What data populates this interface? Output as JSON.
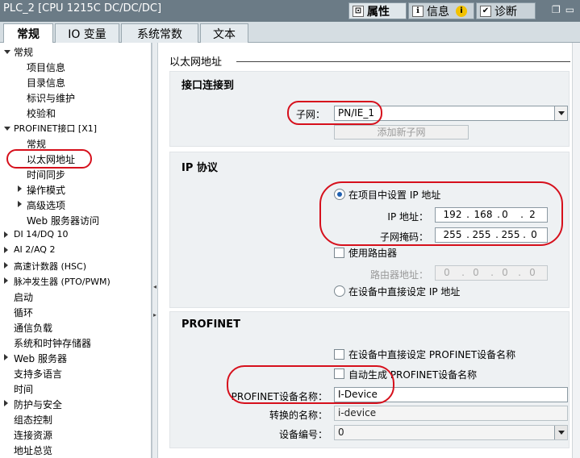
{
  "titlebar": {
    "title": "PLC_2 [CPU 1215C DC/DC/DC]",
    "tabs": [
      {
        "label": "属性",
        "icon": "properties-icon"
      },
      {
        "label": "信息",
        "icon": "info-icon"
      },
      {
        "label": "诊断",
        "icon": "diagnostics-icon"
      }
    ],
    "info_badge": "i"
  },
  "main_tabs": [
    "常规",
    "IO 变量",
    "系统常数",
    "文本"
  ],
  "tree": [
    "常规",
    "项目信息",
    "目录信息",
    "标识与维护",
    "校验和",
    "PROFINET接口 [X1]",
    "常规",
    "以太网地址",
    "时间同步",
    "操作模式",
    "高级选项",
    "Web 服务器访问",
    "DI 14/DQ 10",
    "AI 2/AQ 2",
    "高速计数器 (HSC)",
    "脉冲发生器 (PTO/PWM)",
    "启动",
    "循环",
    "通信负载",
    "系统和时钟存储器",
    "Web 服务器",
    "支持多语言",
    "时间",
    "防护与安全",
    "组态控制",
    "连接资源",
    "地址总览"
  ],
  "panel": {
    "header": "以太网地址",
    "interface": {
      "title": "接口连接到",
      "subnet_label": "子网：",
      "subnet_value": "PN/IE_1",
      "add_subnet": "添加新子网"
    },
    "ip": {
      "title": "IP 协议",
      "radio_project": "在项目中设置 IP 地址",
      "ip_label": "IP 地址：",
      "ip_value": [
        "192",
        "168",
        "0",
        "2"
      ],
      "mask_label": "子网掩码：",
      "mask_value": [
        "255",
        "255",
        "255",
        "0"
      ],
      "use_router": "使用路由器",
      "router_label": "路由器地址：",
      "router_value": [
        "0",
        "0",
        "0",
        "0"
      ],
      "radio_device": "在设备中直接设定 IP 地址"
    },
    "profinet": {
      "title": "PROFINET",
      "chk_direct": "在设备中直接设定 PROFINET设备名称",
      "chk_auto": "自动生成 PROFINET设备名称",
      "name_label": "PROFINET设备名称：",
      "name_value": "I-Device",
      "converted_label": "转换的名称：",
      "converted_value": "i-device",
      "devnum_label": "设备编号：",
      "devnum_value": "0"
    }
  },
  "colors": {
    "annotation": "#d6101c",
    "titlebar": "#6b7b86",
    "section_bg": "#eef1f3"
  }
}
